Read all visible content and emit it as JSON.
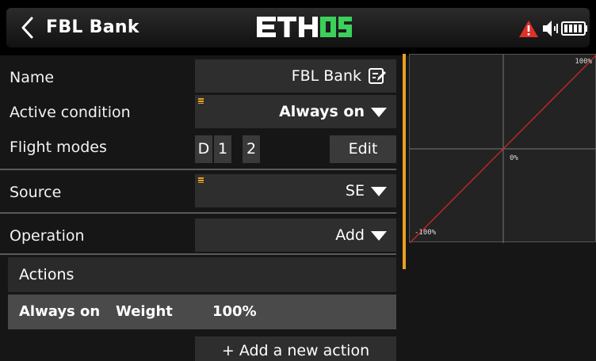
{
  "header": {
    "title": "FBL Bank",
    "logo_text": "ETHOS",
    "icons": [
      "back-icon",
      "warning-icon",
      "speaker-icon",
      "battery-icon"
    ]
  },
  "rows": {
    "name": {
      "label": "Name",
      "value": "FBL Bank"
    },
    "active_condition": {
      "label": "Active condition",
      "value": "Always on"
    },
    "flight_modes": {
      "label": "Flight modes",
      "modes": [
        "D",
        "1",
        "2"
      ],
      "edit_label": "Edit"
    },
    "source": {
      "label": "Source",
      "value": "SE"
    },
    "operation": {
      "label": "Operation",
      "value": "Add"
    }
  },
  "actions": {
    "header": "Actions",
    "items": [
      {
        "condition": "Always on",
        "weight_label": "Weight",
        "weight_value": "100%"
      }
    ],
    "add_label": "+ Add a new action"
  },
  "curve": {
    "top_label": "100%",
    "center_label": "0%",
    "bottom_label": "-100%"
  },
  "colors": {
    "accent": "#e8a020",
    "logo_green": "#3cd05a",
    "warning": "#e0302a",
    "curve_line": "#d02828"
  }
}
